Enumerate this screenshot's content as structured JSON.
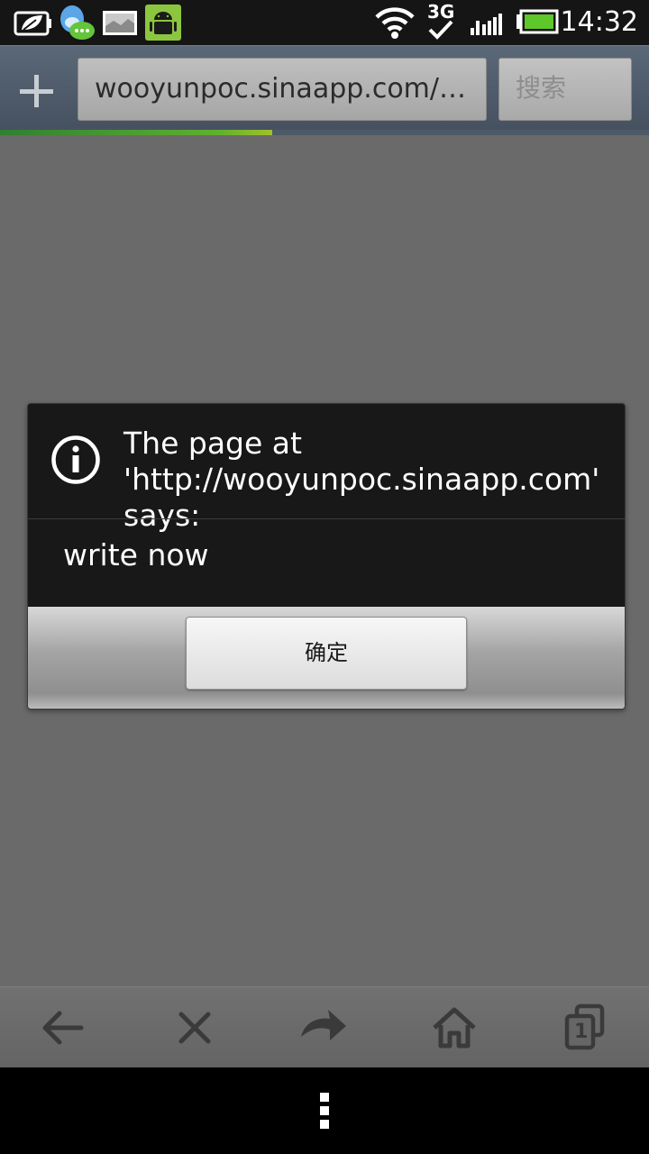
{
  "status_bar": {
    "time": "14:32",
    "network_type": "3G",
    "icons": [
      "battery-saver-icon",
      "qq-chat-icon",
      "screenshot-icon",
      "android-icon",
      "wifi-icon",
      "3g-icon",
      "signal-icon",
      "battery-icon"
    ]
  },
  "browser": {
    "url": "wooyunpoc.sinaapp.com/ff...",
    "search_label": "搜索",
    "load_progress": 0.42
  },
  "dialog": {
    "title": "The page at 'http://wooyunpoc.sinaapp.com' says:",
    "message": "write now",
    "ok_label": "确定"
  },
  "toolbar": {
    "icons": [
      "back-arrow-icon",
      "close-icon",
      "forward-arrow-icon",
      "home-icon",
      "tabs-icon"
    ],
    "tab_count": "1"
  },
  "colors": {
    "progress": "#5fb12e",
    "dialog_bg": "#181818",
    "page_dim": "#6a6a6a"
  }
}
